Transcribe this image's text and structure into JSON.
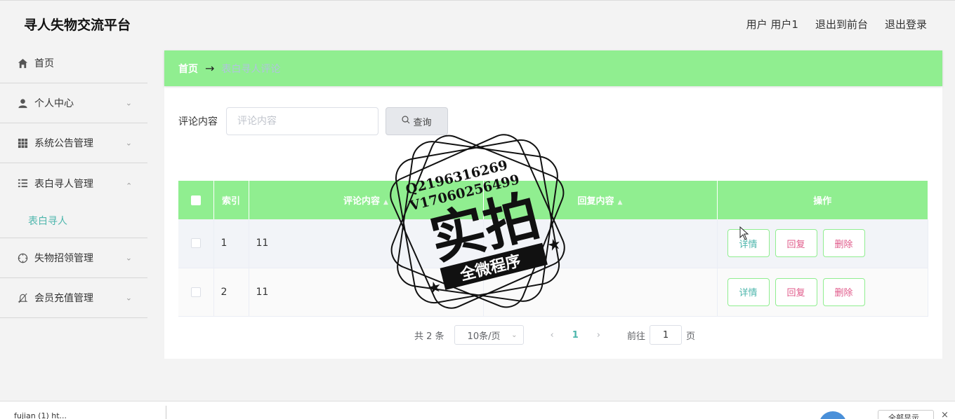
{
  "header": {
    "app_title": "寻人失物交流平台",
    "user_label": "用户 用户1",
    "back_front": "退出到前台",
    "logout": "退出登录"
  },
  "sidebar": {
    "items": [
      {
        "label": "首页",
        "icon": "home-icon"
      },
      {
        "label": "个人中心",
        "icon": "user-icon"
      },
      {
        "label": "系统公告管理",
        "icon": "grid-icon"
      },
      {
        "label": "表白寻人管理",
        "icon": "list-icon"
      },
      {
        "label": "失物招领管理",
        "icon": "compass-icon"
      },
      {
        "label": "会员充值管理",
        "icon": "bell-off-icon"
      }
    ],
    "sub_item": "表白寻人"
  },
  "breadcrumb": {
    "home": "首页",
    "separator": "→",
    "current": "表白寻人评论"
  },
  "search": {
    "label": "评论内容",
    "placeholder": "评论内容",
    "button": "查询"
  },
  "table": {
    "headers": [
      "索引",
      "评论内容",
      "回复内容",
      "操作"
    ],
    "rows": [
      {
        "index": "1",
        "comment": "11",
        "reply": ""
      },
      {
        "index": "2",
        "comment": "11",
        "reply": ""
      }
    ],
    "actions": {
      "detail": "详情",
      "reply": "回复",
      "delete": "删除"
    }
  },
  "pagination": {
    "total": "共 2 条",
    "page_size": "10条/页",
    "current_page": "1",
    "goto_label": "前往",
    "goto_value": "1",
    "page_suffix": "页"
  },
  "watermark": {
    "line1": "Q2196316269",
    "line2": "V17060256499",
    "main": "实拍",
    "banner": "全微程序"
  },
  "download_bar": {
    "file": "fujian (1) ht...",
    "show_all": "全部显示",
    "close": "×"
  },
  "colors": {
    "accent_green": "#90ee90",
    "teal": "#4db6ac",
    "pink": "#e05a8a"
  }
}
